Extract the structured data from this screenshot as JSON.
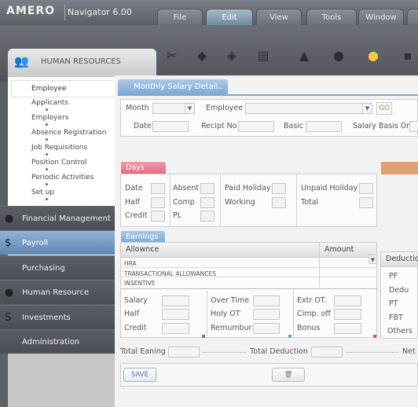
{
  "app": {
    "logo": "AMERO",
    "subtitle": "Navigator 6.00"
  },
  "tabs": [
    "File",
    "Edit",
    "View",
    "Tools",
    "Window"
  ],
  "active_tab": "Edit",
  "toolbar_icons": [
    "scissors-icon",
    "layers-icon",
    "tags-icon",
    "book-icon",
    "graduation-cap-icon",
    "person-icon",
    "lightbulb-icon",
    "chat-icon"
  ],
  "sidebar": {
    "header": "HUMAN RESOURCES",
    "submenu": [
      "Employee",
      "Applicants",
      "Employers",
      "Absence Registration",
      "Job Requisitions",
      "Position Control",
      "Periodic Activities",
      "Set up"
    ],
    "modules": [
      "Financial Management",
      "Payroll",
      "Purchasing",
      "Human Resource",
      "Investments",
      "Administration"
    ]
  },
  "form": {
    "title": "Monthly Salary  Detail..",
    "month_label": "Month",
    "employee_label": "Employee",
    "go": "GO",
    "date_label": "Date",
    "recipt_label": "Recipt No",
    "basic_label": "Basic",
    "salary_basis_label": "Salary Basis On"
  },
  "days": {
    "title": "Days",
    "labels": [
      "Date",
      "Absent",
      "Paid Holiday",
      "Unpaid Holiday",
      "Half",
      "Comp",
      "Working",
      "Total",
      "Credit",
      "PL"
    ]
  },
  "earnings": {
    "title": "Earnings",
    "col_allowance": "Allownce",
    "col_amount": "Amount",
    "rows": [
      "HRA",
      "TRANSACTIONAL ALLOWANCES",
      "INSENTIVE"
    ],
    "deduction_header": "Deduction",
    "deductions": [
      "PF",
      "Dedu",
      "PT",
      "FBT",
      "Others"
    ],
    "fields": [
      "Salary",
      "Over Time",
      "Extr OT.",
      "Half",
      "Holy OT",
      "Cimp. off",
      "Credit",
      "Remumbur",
      "Bonus"
    ]
  },
  "totals": {
    "total_earning": "Total Eaning",
    "total_deduction": "Total Deduction",
    "net": "Net S"
  },
  "buttons": {
    "save": "SAVE"
  },
  "colors": {
    "accent_blue": "#7da9d4",
    "days_red": "#e06a80",
    "go_green": "#7aa05a"
  }
}
